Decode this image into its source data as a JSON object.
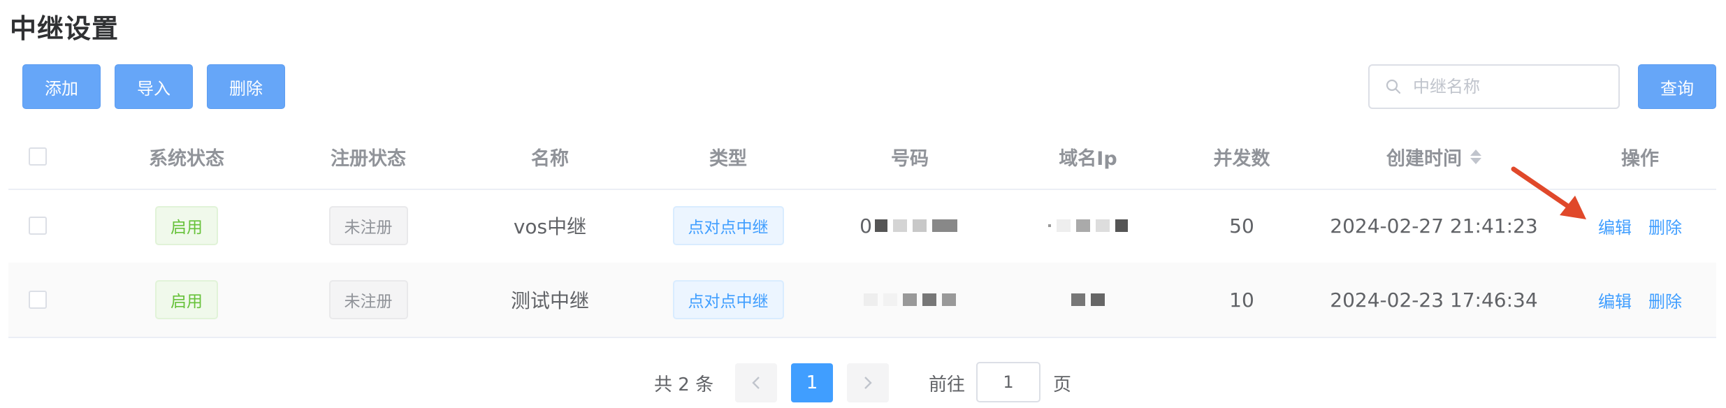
{
  "page": {
    "title": "中继设置"
  },
  "toolbar": {
    "add": "添加",
    "import": "导入",
    "delete": "删除",
    "search_placeholder": "中继名称",
    "query": "查询"
  },
  "table": {
    "headers": {
      "system_status": "系统状态",
      "register_status": "注册状态",
      "name": "名称",
      "type": "类型",
      "number": "号码",
      "domain_ip": "域名Ip",
      "concurrency": "并发数",
      "created_time": "创建时间",
      "actions": "操作"
    },
    "rows": [
      {
        "system_status": "启用",
        "register_status": "未注册",
        "name": "vos中继",
        "type": "点对点中继",
        "number": "0",
        "domain_ip": "",
        "concurrency": "50",
        "created_time": "2024-02-27 21:41:23",
        "edit": "编辑",
        "delete": "删除"
      },
      {
        "system_status": "启用",
        "register_status": "未注册",
        "name": "测试中继",
        "type": "点对点中继",
        "number": "",
        "domain_ip": "",
        "concurrency": "10",
        "created_time": "2024-02-23 17:46:34",
        "edit": "编辑",
        "delete": "删除"
      }
    ]
  },
  "pagination": {
    "total": "共 2 条",
    "current": "1",
    "goto_label": "前往",
    "goto_value": "1",
    "page_suffix": "页"
  },
  "colors": {
    "primary": "#409eff",
    "button": "#66a6f8",
    "enabled": "#67c23a",
    "arrow": "#e0482a"
  }
}
